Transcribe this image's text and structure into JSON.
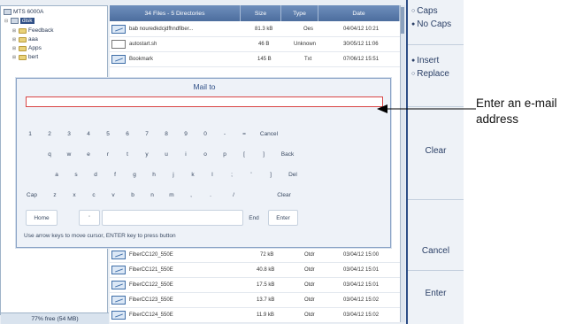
{
  "tree": {
    "root": "MTS 6000A",
    "selected": "disk",
    "nodes": [
      "Feedback",
      "aaa",
      "Apps",
      "bert"
    ],
    "free": "77% free (54 MB)"
  },
  "table": {
    "headers": [
      "34 Files - 5 Directories",
      "Size",
      "Type",
      "Date"
    ],
    "top_rows": [
      {
        "name": "bab nouredkdcjdfhndfiber...",
        "size": "81.3 kB",
        "type": "Oes",
        "date": "04/04/12 10:21",
        "icon": "file-icon"
      },
      {
        "name": "autostart.sh",
        "size": "46 B",
        "type": "Unknown",
        "date": "30/05/12 11:06",
        "icon": "plain-file-icon"
      },
      {
        "name": "Bookmark",
        "size": "145 B",
        "type": "Txt",
        "date": "07/06/12 15:51",
        "icon": "file-icon"
      }
    ],
    "bottom_rows": [
      {
        "name": "FiberCC120_550E",
        "size": "72 kB",
        "type": "Otdr",
        "date": "03/04/12 15:00",
        "icon": "file-icon"
      },
      {
        "name": "FiberCC121_550E",
        "size": "40.8 kB",
        "type": "Otdr",
        "date": "03/04/12 15:01",
        "icon": "file-icon"
      },
      {
        "name": "FiberCC122_550E",
        "size": "17.5 kB",
        "type": "Otdr",
        "date": "03/04/12 15:01",
        "icon": "file-icon"
      },
      {
        "name": "FiberCC123_550E",
        "size": "13.7 kB",
        "type": "Otdr",
        "date": "03/04/12 15:02",
        "icon": "file-icon"
      },
      {
        "name": "FiberCC124_550E",
        "size": "11.9 kB",
        "type": "Otdr",
        "date": "03/04/12 15:02",
        "icon": "file-icon"
      }
    ]
  },
  "dialog": {
    "title": "Mail to",
    "input_value": "",
    "keys": {
      "row1": [
        "1",
        "2",
        "3",
        "4",
        "5",
        "6",
        "7",
        "8",
        "9",
        "0",
        "-",
        "=",
        "Cancel"
      ],
      "row2": [
        "q",
        "w",
        "e",
        "r",
        "t",
        "y",
        "u",
        "i",
        "o",
        "p",
        "[",
        "]",
        "Back"
      ],
      "row3": [
        "a",
        "s",
        "d",
        "f",
        "g",
        "h",
        "j",
        "k",
        "l",
        ";",
        "'",
        "]",
        "Del"
      ],
      "row4": [
        "Cap",
        "z",
        "x",
        "c",
        "v",
        "b",
        "n",
        "m",
        ",",
        ".",
        "/",
        "Clear"
      ],
      "row5": [
        "Home",
        "'",
        "",
        "End",
        "Enter"
      ]
    },
    "help": "Use arrow keys to move cursor, ENTER key to press button"
  },
  "side": {
    "caps": "Caps",
    "no_caps": "No Caps",
    "insert": "Insert",
    "replace": "Replace",
    "clear": "Clear",
    "cancel": "Cancel",
    "enter": "Enter"
  },
  "callout": {
    "text": "Enter an e-mail address"
  },
  "colors": {
    "header_blue": "#4c6d9e",
    "panel_border": "#2d4e86",
    "input_border": "#d94545",
    "arrow": "#000000"
  }
}
